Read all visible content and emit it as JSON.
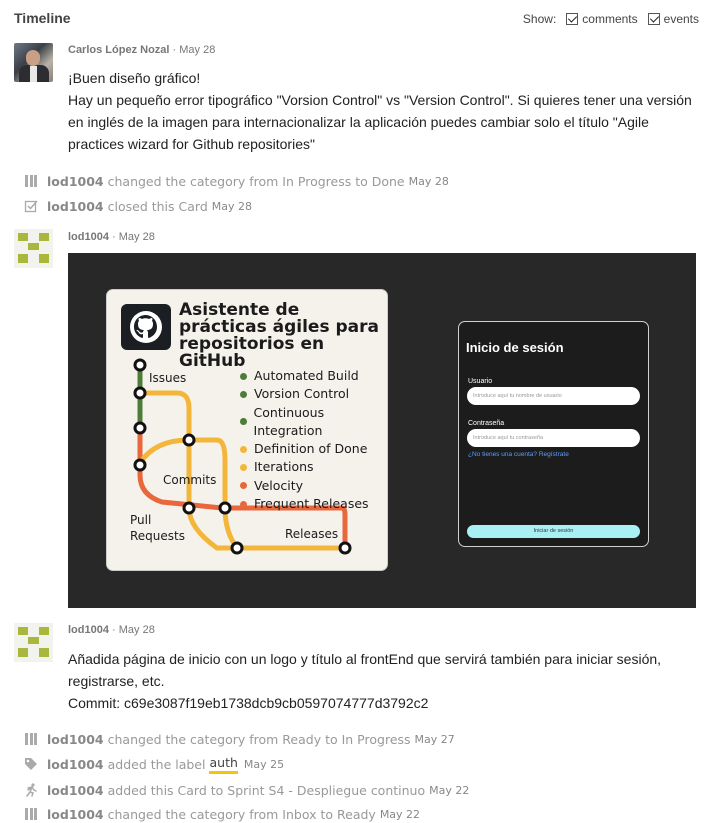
{
  "header": {
    "title": "Timeline",
    "show_label": "Show:",
    "filters": [
      {
        "label": "comments",
        "checked": true
      },
      {
        "label": "events",
        "checked": true
      }
    ]
  },
  "entries": {
    "comment1": {
      "author": "Carlos López Nozal",
      "separator": "·",
      "date": "May 28",
      "lines": [
        "¡Buen diseño gráfico!",
        "Hay un pequeño error tipográfico \"Vorsion Control\" vs \"Version Control\". Si quieres tener una versión",
        "en inglés de la imagen para internacionalizar la aplicación puedes cambiar solo el título \"Agile",
        "practices wizard for Github repositories\""
      ]
    },
    "event1": {
      "actor": "lod1004",
      "text": "changed the category from In Progress to Done",
      "date": "May 28",
      "icon": "columns-icon"
    },
    "event2": {
      "actor": "lod1004",
      "text": "closed this Card",
      "date": "May 28",
      "icon": "checkbox-closed-icon"
    },
    "comment2": {
      "author": "lod1004",
      "separator": "·",
      "date": "May 28",
      "image": {
        "card_title": "Asistente de prácticas ágiles para repositorios en GitHub",
        "legend": [
          {
            "label": "Automated Build",
            "color": "#4e7d3a"
          },
          {
            "label": "Vorsion Control",
            "color": "#4e7d3a"
          },
          {
            "label": "Continuous Integration",
            "color": "#4e7d3a"
          },
          {
            "label": "Definition of Done",
            "color": "#f3b63b"
          },
          {
            "label": "Iterations",
            "color": "#f3b63b"
          },
          {
            "label": "Velocity",
            "color": "#e8673c"
          },
          {
            "label": "Frequent Releases",
            "color": "#e8673c"
          }
        ],
        "metro_labels": {
          "issues": "Issues",
          "commits": "Commits",
          "pull_requests": "Pull Requests",
          "releases": "Releases"
        },
        "login": {
          "title": "Inicio de sesión",
          "user_label": "Usuario",
          "user_placeholder": "Introduce aquí tu nombre de usuario",
          "pass_label": "Contraseña",
          "pass_placeholder": "Introduce aquí tu contraseña",
          "register_link": "¿No tienes una cuenta? Regístrate",
          "submit": "Iniciar de sesión"
        }
      }
    },
    "comment3": {
      "author": "lod1004",
      "separator": "·",
      "date": "May 28",
      "lines": [
        "Añadida página de inicio con un logo y título al frontEnd que servirá también para iniciar sesión,",
        "registrarse, etc.",
        "Commit: c69e3087f19eb1738dcb9cb0597074777d3792c2"
      ]
    },
    "event3": {
      "actor": "lod1004",
      "text": "changed the category from Ready to In Progress",
      "date": "May 27",
      "icon": "columns-icon"
    },
    "event4": {
      "actor": "lod1004",
      "text": "added the label",
      "label": "auth",
      "label_color": "#f2c40b",
      "date": "May 25",
      "icon": "tag-icon"
    },
    "event5": {
      "actor": "lod1004",
      "text": "added this Card to Sprint S4 - Despliegue continuo",
      "date": "May 22",
      "icon": "sprint-runner-icon"
    },
    "event6": {
      "actor": "lod1004",
      "text": "changed the category from Inbox to Ready",
      "date": "May 22",
      "icon": "columns-icon"
    }
  }
}
